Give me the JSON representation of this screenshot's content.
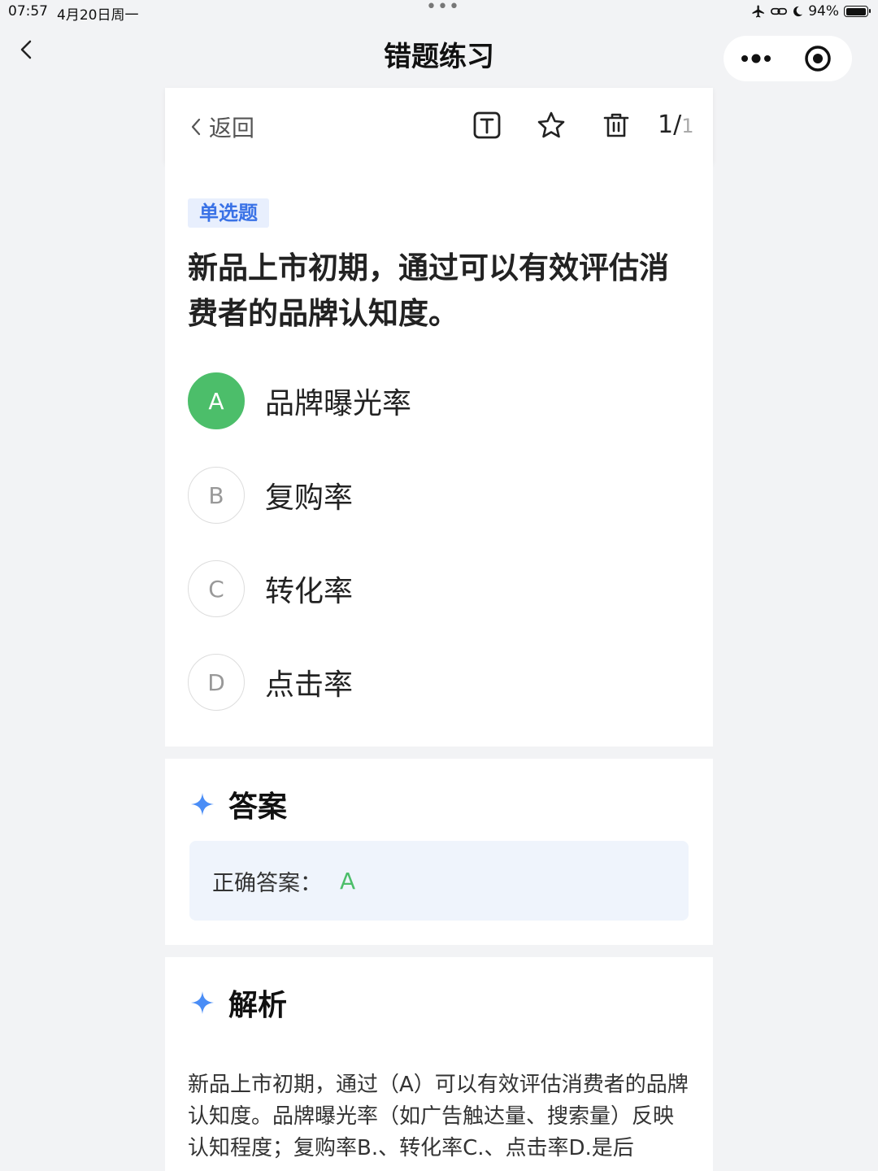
{
  "status": {
    "time": "07:57",
    "date": "4月20日周一",
    "battery": "94%"
  },
  "nav": {
    "title": "错题练习"
  },
  "toolbar": {
    "back_label": "返回",
    "page_current": "1",
    "page_total": "1"
  },
  "question": {
    "type_tag": "单选题",
    "text": "新品上市初期，通过可以有效评估消费者的品牌认知度。",
    "options": [
      {
        "letter": "A",
        "text": "品牌曝光率"
      },
      {
        "letter": "B",
        "text": "复购率"
      },
      {
        "letter": "C",
        "text": "转化率"
      },
      {
        "letter": "D",
        "text": "点击率"
      }
    ],
    "correct": "A"
  },
  "answer": {
    "heading": "答案",
    "label": "正确答案：",
    "value": "A"
  },
  "analysis": {
    "heading": "解析",
    "text": "新品上市初期，通过（A）可以有效评估消费者的品牌认知度。品牌曝光率（如广告触达量、搜索量）反映认知程度；复购率B.、转化率C.、点击率D.是后"
  },
  "colors": {
    "correct_green": "#4cbe6a",
    "tag_blue": "#3a72e6",
    "answer_bg": "#eff4fc",
    "page_bg": "#f2f3f5"
  },
  "icons": [
    "chevron-left-icon",
    "text-size-icon",
    "star-icon",
    "trash-icon",
    "more-dots-icon",
    "target-icon",
    "sparkle-icon",
    "airplane-icon",
    "battery-icon"
  ]
}
